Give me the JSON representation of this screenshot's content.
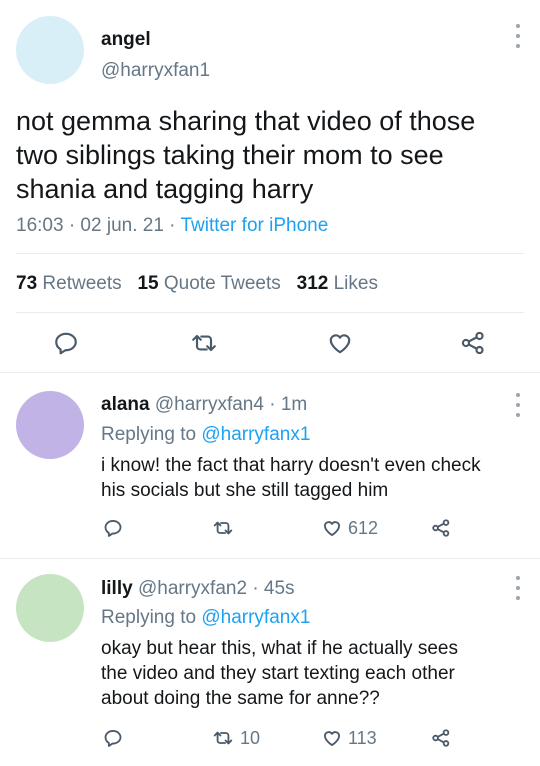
{
  "main_tweet": {
    "name": "angel",
    "handle": "@harryxfan1",
    "text_lines": [
      "not gemma sharing that video of those",
      "two siblings taking their mom to see",
      "shania and tagging harry"
    ],
    "timestamp": "16:03 · 02 jun. 21 · ",
    "source": "Twitter for iPhone",
    "stats": {
      "retweets_count": "73",
      "retweets_label": "Retweets",
      "quotes_count": "15",
      "quotes_label": "Quote Tweets",
      "likes_count": "312",
      "likes_label": "Likes"
    },
    "avatar_color": "#d9eff7"
  },
  "replies": [
    {
      "name": "alana",
      "handle": "@harryxfan4",
      "time": "· 1m",
      "replying_prefix": "Replying to",
      "replying_to": "@harryfanx1",
      "text_lines": [
        "i know! the fact that harry doesn't even check",
        "his socials but she still tagged him"
      ],
      "retweet_count": "",
      "like_count": "612",
      "avatar_color": "#c2b3e6"
    },
    {
      "name": "lilly",
      "handle": "@harryxfan2",
      "time": "· 45s",
      "replying_prefix": "Replying to",
      "replying_to": "@harryfanx1",
      "text_lines": [
        "okay but hear this, what if he actually sees",
        "the video and they start texting each other",
        "about doing the same for anne??"
      ],
      "retweet_count": "10",
      "like_count": "113",
      "avatar_color": "#c6e3c2"
    }
  ],
  "colors": {
    "accent": "#1da1f2",
    "muted": "#657786",
    "icon": "#4a5a6a"
  }
}
